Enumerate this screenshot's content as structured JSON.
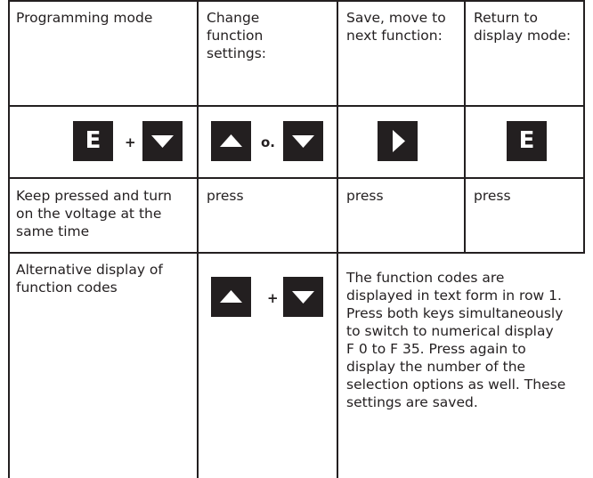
{
  "table": {
    "headers": [
      "Programming mode",
      "Change\nfunction\nsettings:",
      "Save, move to\nnext function:",
      "Return to\ndisplay mode:"
    ],
    "keys_row": {
      "col1_key1": "E",
      "col1_sep": "+",
      "col2_sep": "o.",
      "col4_key": "E"
    },
    "row3": [
      "Keep pressed and turn\non the voltage at the\nsame time",
      "press",
      "press",
      "press"
    ],
    "row4": {
      "label": "Alternative display of\nfunction codes",
      "sep": "+",
      "description": "The function codes are\ndisplayed in text form in row 1.\nPress both keys simultaneously\nto switch to numerical display\nF 0 to F 35. Press again to\ndisplay the number of the\nselection options as well. These\nsettings are saved."
    }
  },
  "icons": {
    "e_key": "e-key-icon",
    "up_arrow": "up-arrow-key-icon",
    "down_arrow": "down-arrow-key-icon",
    "right_arrow": "right-arrow-key-icon"
  }
}
